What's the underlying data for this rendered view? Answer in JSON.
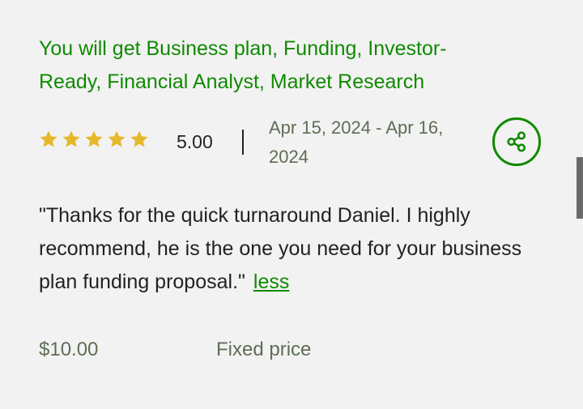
{
  "job": {
    "title": "You will get Business plan, Funding, Investor-Ready, Financial Analyst, Market Research"
  },
  "rating": {
    "stars": 5,
    "score": "5.00",
    "star_color": "#e5b82b"
  },
  "dates": "Apr 15, 2024 - Apr 16, 2024",
  "share": {
    "icon": "share-icon"
  },
  "review": {
    "text": "\"Thanks for the quick turnaround Daniel. I highly recommend, he is the one you need for your business plan funding proposal.\"",
    "less_label": "less"
  },
  "price": {
    "amount": "$10.00",
    "type": "Fixed price"
  },
  "colors": {
    "accent": "#108a00",
    "background": "#f2f2f2",
    "text": "#222222",
    "muted": "#5e6d55"
  }
}
